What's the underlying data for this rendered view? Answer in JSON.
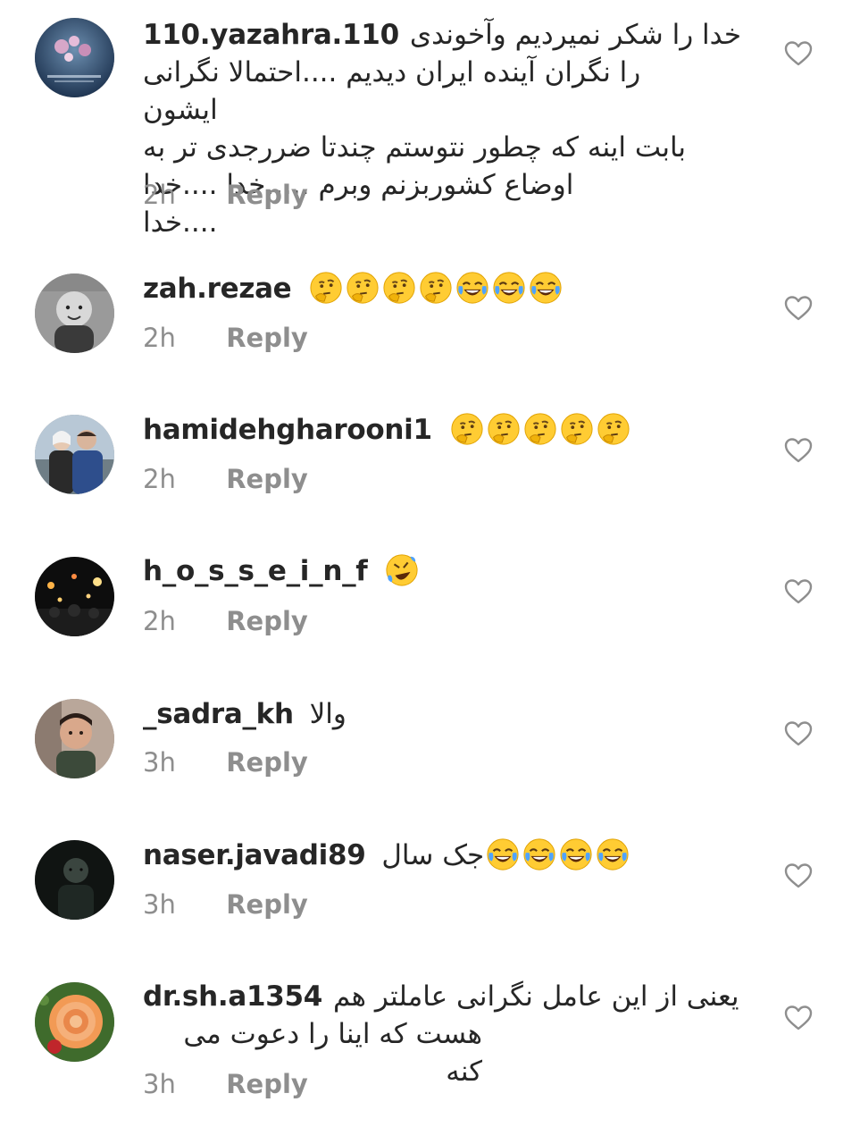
{
  "comments": [
    {
      "username": "110.yazahra.110",
      "lines": [
        "خدا را شکر نمیردیم وآخوندی",
        "را نگران آینده ایران دیدیم ....احتمالا نگرانی ایشون",
        "بابت اینه که چطور نتوستم چندتا ضررجدی تر به",
        "اوضاع کشوربزنم وبرم .....خدا ....خدا ....خدا"
      ],
      "time": "2h",
      "reply_label": "Reply",
      "avatar": "flowers-photo",
      "emojis": []
    },
    {
      "username": "zah.rezae",
      "text": "",
      "emojis": [
        "thinking-face",
        "thinking-face",
        "thinking-face",
        "thinking-face",
        "tears-of-joy",
        "tears-of-joy",
        "tears-of-joy"
      ],
      "time": "2h",
      "reply_label": "Reply",
      "avatar": "child-photo-bw"
    },
    {
      "username": "hamidehgharooni1",
      "text": "",
      "emojis": [
        "thinking-face",
        "thinking-face",
        "thinking-face",
        "thinking-face",
        "thinking-face"
      ],
      "time": "2h",
      "reply_label": "Reply",
      "avatar": "couple-photo"
    },
    {
      "username": "h_o_s_s_e_i_n_f",
      "text": "",
      "emojis": [
        "rolling-on-floor-laughing"
      ],
      "time": "2h",
      "reply_label": "Reply",
      "avatar": "night-crowd-photo"
    },
    {
      "username": "_sadra_kh",
      "text": "والا",
      "emojis": [],
      "time": "3h",
      "reply_label": "Reply",
      "avatar": "boy-photo"
    },
    {
      "username": "naser.javadi89",
      "text": "جک سال",
      "emojis": [
        "tears-of-joy",
        "tears-of-joy",
        "tears-of-joy",
        "tears-of-joy"
      ],
      "time": "3h",
      "reply_label": "Reply",
      "avatar": "dark-portrait-photo"
    },
    {
      "username": "dr.sh.a1354",
      "lines": [
        "یعنی از این عامل نگرانی عاملتر هم",
        "هست که اینا را دعوت می کنه"
      ],
      "emojis": [],
      "time": "3h",
      "reply_label": "Reply",
      "avatar": "orange-rose-photo"
    }
  ],
  "colors": {
    "text": "#262626",
    "muted": "#8e8e8e",
    "emoji_yellow": "#ffcc33"
  }
}
